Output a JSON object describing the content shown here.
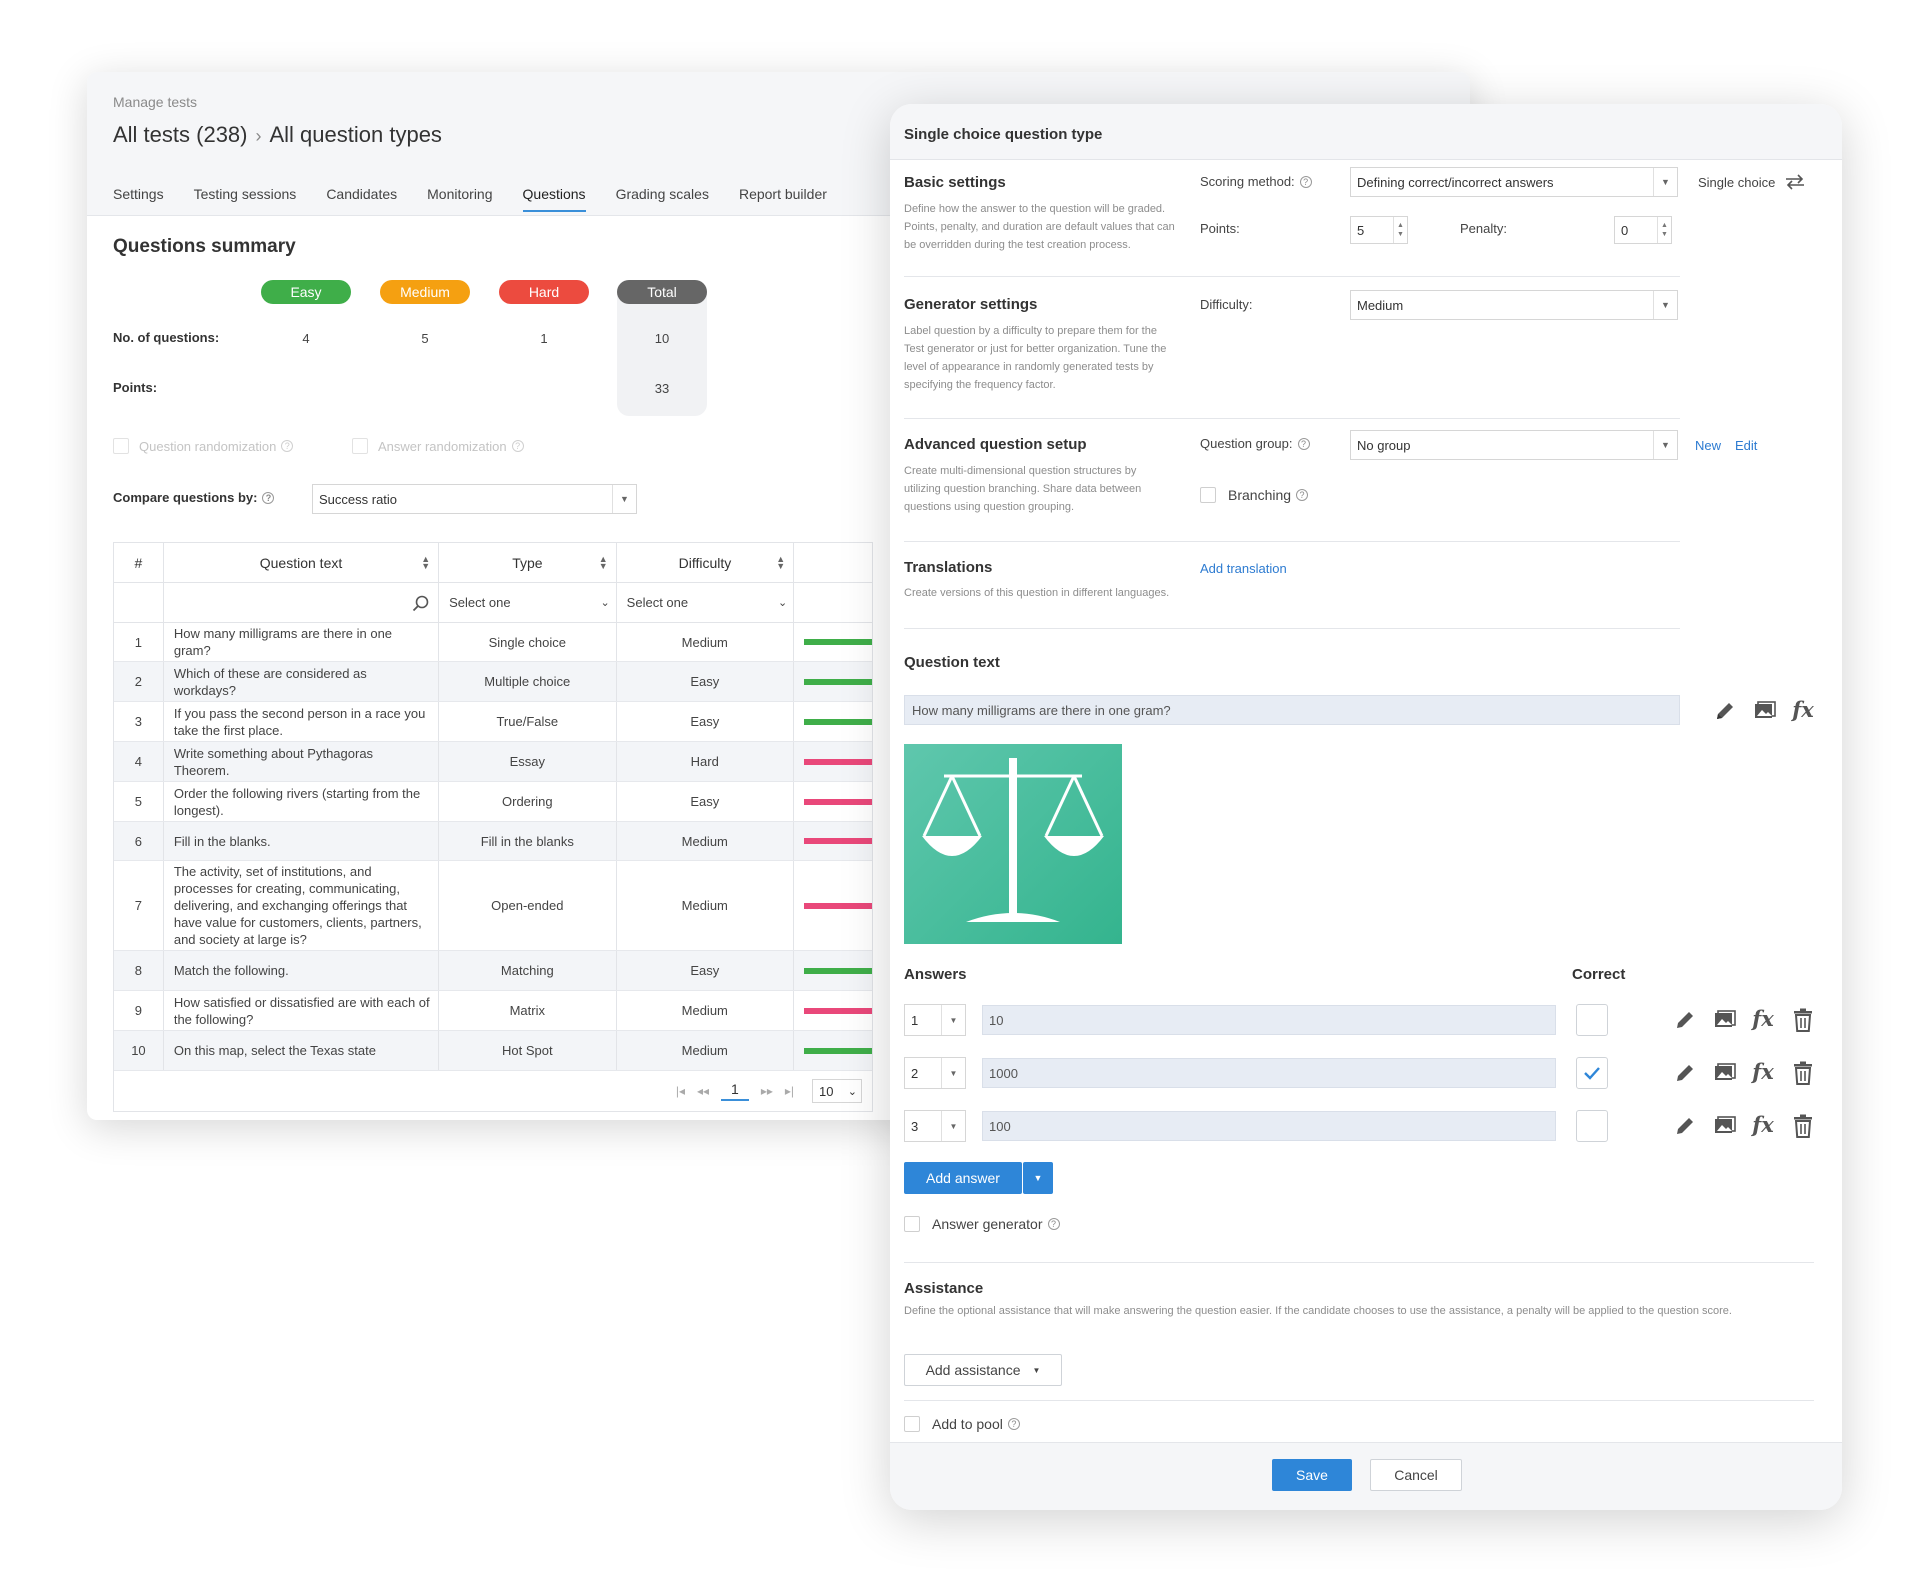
{
  "back": {
    "breadcrumb": "Manage tests",
    "title_part1": "All tests (238)",
    "title_sep": "›",
    "title_part2": "All question types",
    "tabs": [
      "Settings",
      "Testing sessions",
      "Candidates",
      "Monitoring",
      "Questions",
      "Grading scales",
      "Report builder"
    ],
    "active_tab": "Questions",
    "summary": {
      "title": "Questions summary",
      "levels": [
        {
          "label": "Easy",
          "color": "#3fae49",
          "questions": "4"
        },
        {
          "label": "Medium",
          "color": "#f5a011",
          "questions": "5"
        },
        {
          "label": "Hard",
          "color": "#ec4b3f",
          "questions": "1"
        },
        {
          "label": "Total",
          "color": "#666666",
          "questions": "10"
        }
      ],
      "questions_label": "No. of questions:",
      "points_label": "Points:",
      "total_points": "33"
    },
    "question_randomization": "Question randomization",
    "answer_randomization": "Answer randomization",
    "compare_label": "Compare questions by:",
    "compare_value": "Success ratio",
    "table": {
      "headers": [
        "#",
        "Question text",
        "Type",
        "Difficulty"
      ],
      "filter_type": "Select one",
      "filter_difficulty": "Select one",
      "rows": [
        {
          "n": "1",
          "text": "How many milligrams are there in one gram?",
          "type": "Single choice",
          "difficulty": "Medium",
          "bar": "#3fae49"
        },
        {
          "n": "2",
          "text": "Which of these are considered as workdays?",
          "type": "Multiple choice",
          "difficulty": "Easy",
          "bar": "#3fae49"
        },
        {
          "n": "3",
          "text": "If you pass the second person in a race you take the first place.",
          "type": "True/False",
          "difficulty": "Easy",
          "bar": "#3fae49"
        },
        {
          "n": "4",
          "text": "Write something about Pythagoras Theorem.",
          "type": "Essay",
          "difficulty": "Hard",
          "bar": "#e9487a"
        },
        {
          "n": "5",
          "text": "Order the following rivers (starting from the longest).",
          "type": "Ordering",
          "difficulty": "Easy",
          "bar": "#e9487a"
        },
        {
          "n": "6",
          "text": "Fill in the blanks.",
          "type": "Fill in the blanks",
          "difficulty": "Medium",
          "bar": "#e9487a"
        },
        {
          "n": "7",
          "text": "The activity, set of institutions, and processes for creating, communicating, delivering, and exchanging offerings that have value for customers, clients, partners, and society at large is?",
          "type": "Open-ended",
          "difficulty": "Medium",
          "bar": "#e9487a"
        },
        {
          "n": "8",
          "text": "Match the following.",
          "type": "Matching",
          "difficulty": "Easy",
          "bar": "#3fae49"
        },
        {
          "n": "9",
          "text": "How satisfied or dissatisfied are with each of the following?",
          "type": "Matrix",
          "difficulty": "Medium",
          "bar": "#e9487a"
        },
        {
          "n": "10",
          "text": "On this map, select the Texas state",
          "type": "Hot Spot",
          "difficulty": "Medium",
          "bar": "#3fae49"
        }
      ],
      "page": "1",
      "page_size": "10"
    }
  },
  "dialog": {
    "title": "Single choice question type",
    "basic": {
      "title": "Basic settings",
      "desc": "Define how the answer to the question will be graded. Points, penalty, and duration are default values that can be overridden during the test creation process.",
      "scoring_label": "Scoring method:",
      "scoring_value": "Defining correct/incorrect answers",
      "type_switch": "Single choice",
      "points_label": "Points:",
      "points_value": "5",
      "penalty_label": "Penalty:",
      "penalty_value": "0"
    },
    "generator": {
      "title": "Generator settings",
      "desc": "Label question by a difficulty to prepare them for the Test generator or just for better organization. Tune the level of appearance in randomly generated tests by specifying the frequency factor.",
      "difficulty_label": "Difficulty:",
      "difficulty_value": "Medium"
    },
    "advanced": {
      "title": "Advanced question setup",
      "desc": "Create multi-dimensional question structures by utilizing question branching. Share data between questions using question grouping.",
      "group_label": "Question group:",
      "group_value": "No group",
      "new_link": "New",
      "edit_link": "Edit",
      "branching": "Branching"
    },
    "translations": {
      "title": "Translations",
      "desc": "Create versions of this question in different languages.",
      "add_link": "Add translation"
    },
    "question_text_label": "Question text",
    "question_text": "How many milligrams are there in one gram?",
    "answers_label": "Answers",
    "correct_label": "Correct",
    "answers": [
      {
        "n": "1",
        "value": "10",
        "correct": false
      },
      {
        "n": "2",
        "value": "1000",
        "correct": true
      },
      {
        "n": "3",
        "value": "100",
        "correct": false
      }
    ],
    "add_answer": "Add answer",
    "answer_generator": "Answer generator",
    "assistance": {
      "title": "Assistance",
      "desc": "Define the optional assistance that will make answering the question easier. If the candidate chooses to use the assistance, a penalty will be applied to the question score.",
      "button": "Add assistance"
    },
    "add_to_pool": "Add to pool",
    "save": "Save",
    "cancel": "Cancel"
  },
  "icons": {
    "sort": "sort-icon",
    "search": "search-icon",
    "help": "help-icon",
    "swap": "swap-icon",
    "edit": "pencil-icon",
    "image": "image-icon",
    "formula": "formula-icon",
    "delete": "trash-icon",
    "check": "check-icon",
    "dropdown": "chevron-down-icon"
  },
  "colors": {
    "accent": "#2e86d8",
    "easy": "#3fae49",
    "medium": "#f5a011",
    "hard": "#ec4b3f",
    "total": "#666666"
  }
}
